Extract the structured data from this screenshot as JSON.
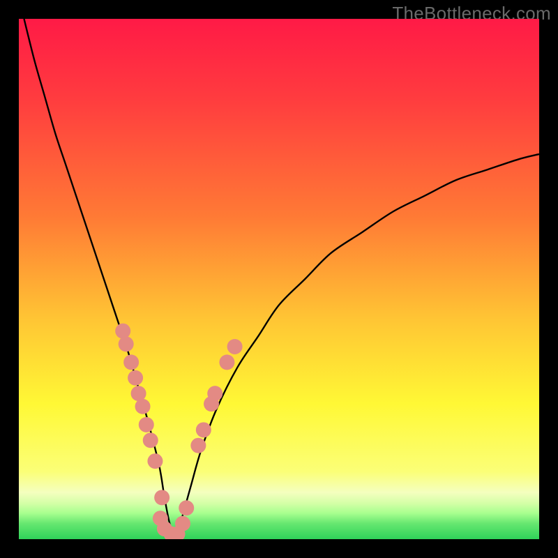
{
  "attribution": "TheBottleneck.com",
  "colors": {
    "background": "#000000",
    "attribution": "#6a6a6a",
    "curve": "#000000",
    "markers": "#e38a84",
    "green": "#2fd35a",
    "greenLight": "#8ff07a"
  },
  "chart_data": {
    "type": "line",
    "title": "",
    "xlabel": "",
    "ylabel": "",
    "xlim": [
      0,
      100
    ],
    "ylim": [
      0,
      100
    ],
    "grid": false,
    "legend": false,
    "annotations": [],
    "gradient_stops": [
      {
        "pct": 0,
        "color": "#ff1a46"
      },
      {
        "pct": 15,
        "color": "#ff3b3f"
      },
      {
        "pct": 38,
        "color": "#ff7a35"
      },
      {
        "pct": 58,
        "color": "#ffc634"
      },
      {
        "pct": 74,
        "color": "#fff835"
      },
      {
        "pct": 87,
        "color": "#fbff77"
      },
      {
        "pct": 91,
        "color": "#f4ffbf"
      },
      {
        "pct": 93,
        "color": "#d6ffa8"
      },
      {
        "pct": 95,
        "color": "#a8ff8f"
      },
      {
        "pct": 97,
        "color": "#66e770"
      },
      {
        "pct": 100,
        "color": "#2fd35a"
      }
    ],
    "series": [
      {
        "name": "bottleneck-curve",
        "x": [
          1,
          3,
          5,
          7,
          9,
          11,
          13,
          15,
          17,
          19,
          21,
          23,
          25,
          27,
          28,
          29,
          30,
          31,
          33,
          35,
          38,
          42,
          46,
          50,
          55,
          60,
          66,
          72,
          78,
          84,
          90,
          96,
          100
        ],
        "values": [
          100,
          92,
          85,
          78,
          72,
          66,
          60,
          54,
          48,
          42,
          36,
          29,
          22,
          14,
          8,
          3,
          1,
          3,
          10,
          17,
          25,
          33,
          39,
          45,
          50,
          55,
          59,
          63,
          66,
          69,
          71,
          73,
          74
        ]
      }
    ],
    "markers": [
      {
        "x": 20.0,
        "y": 40.0
      },
      {
        "x": 20.6,
        "y": 37.5
      },
      {
        "x": 21.6,
        "y": 34.0
      },
      {
        "x": 22.4,
        "y": 31.0
      },
      {
        "x": 23.0,
        "y": 28.0
      },
      {
        "x": 23.8,
        "y": 25.5
      },
      {
        "x": 24.5,
        "y": 22.0
      },
      {
        "x": 25.3,
        "y": 19.0
      },
      {
        "x": 26.2,
        "y": 15.0
      },
      {
        "x": 27.5,
        "y": 8.0
      },
      {
        "x": 27.2,
        "y": 4.0
      },
      {
        "x": 28.0,
        "y": 2.0
      },
      {
        "x": 29.3,
        "y": 1.0
      },
      {
        "x": 30.5,
        "y": 1.0
      },
      {
        "x": 31.5,
        "y": 3.0
      },
      {
        "x": 32.2,
        "y": 6.0
      },
      {
        "x": 34.5,
        "y": 18.0
      },
      {
        "x": 35.5,
        "y": 21.0
      },
      {
        "x": 37.0,
        "y": 26.0
      },
      {
        "x": 37.7,
        "y": 28.0
      },
      {
        "x": 40.0,
        "y": 34.0
      },
      {
        "x": 41.5,
        "y": 37.0
      }
    ]
  }
}
